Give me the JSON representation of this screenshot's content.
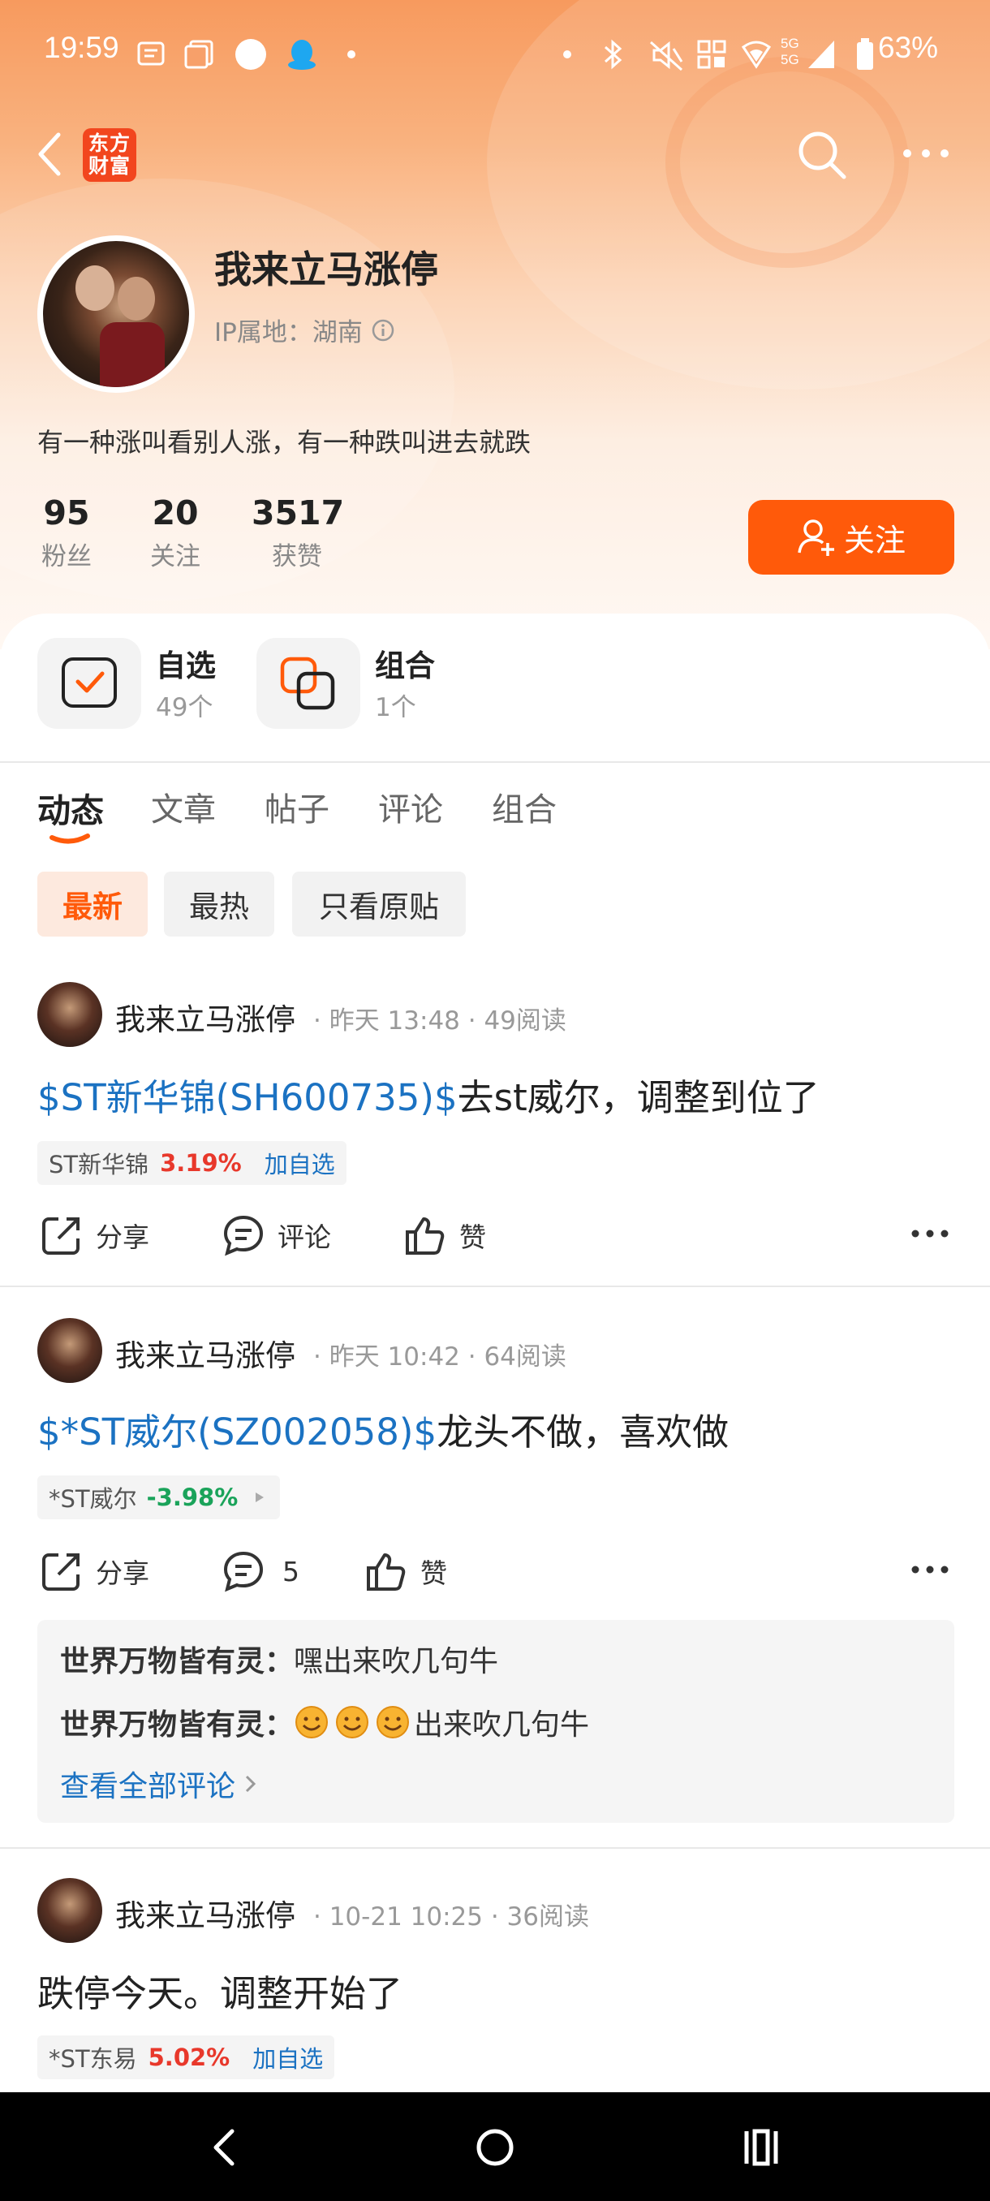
{
  "status_bar": {
    "time": "19:59",
    "network": "5G 5G",
    "battery": "63%"
  },
  "header": {
    "logo_text": "东方财富"
  },
  "profile": {
    "name": "我来立马涨停",
    "ip_label": "IP属地：",
    "ip_location": "湖南",
    "bio": "有一种涨叫看别人涨，有一种跌叫进去就跌",
    "stats": [
      {
        "value": "95",
        "label": "粉丝"
      },
      {
        "value": "20",
        "label": "关注"
      },
      {
        "value": "3517",
        "label": "获赞"
      }
    ],
    "follow_label": "关注"
  },
  "quick_links": [
    {
      "title": "自选",
      "sub": "49个"
    },
    {
      "title": "组合",
      "sub": "1个"
    }
  ],
  "tabs": [
    "动态",
    "文章",
    "帖子",
    "评论",
    "组合"
  ],
  "active_tab": "动态",
  "filters": [
    "最新",
    "最热",
    "只看原贴"
  ],
  "active_filter": "最新",
  "posts": [
    {
      "author": "我来立马涨停",
      "meta": "· 昨天 13:48 · 49阅读",
      "stock_link": "$ST新华锦(SH600735)$",
      "text": "去st威尔，调整到位了",
      "tag_name": "ST新华锦",
      "tag_change": "3.19%",
      "tag_action": "加自选",
      "share": "分享",
      "comment": "评论",
      "like": "赞"
    },
    {
      "author": "我来立马涨停",
      "meta": "· 昨天 10:42 · 64阅读",
      "stock_link": "$*ST威尔(SZ002058)$",
      "text": "龙头不做，喜欢做",
      "tag_name": "*ST威尔",
      "tag_change": "-3.98%",
      "share": "分享",
      "comment": "5",
      "like": "赞",
      "comments": [
        {
          "user": "世界万物皆有灵：",
          "text": "嘿出来吹几句牛"
        },
        {
          "user": "世界万物皆有灵：",
          "text": "出来吹几句牛"
        }
      ],
      "view_all": "查看全部评论"
    },
    {
      "author": "我来立马涨停",
      "meta": "· 10-21 10:25 · 36阅读",
      "text": "跌停今天。调整开始了",
      "tag_name": "*ST东易",
      "tag_change": "5.02%",
      "tag_action": "加自选"
    }
  ],
  "colors": {
    "accent": "#ff5a0a",
    "rise": "#e8382b",
    "fall": "#1aa35a",
    "link": "#1b72c2"
  }
}
